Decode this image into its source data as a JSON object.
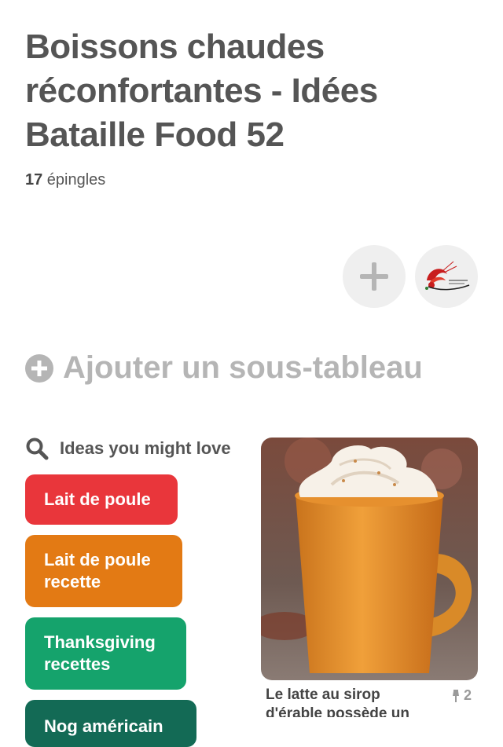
{
  "board": {
    "title": "Boissons chaudes réconfortantes - Idées Bataille Food 52",
    "pin_count": "17",
    "pin_count_label": " épingles"
  },
  "actions": {
    "add_icon": "plus-icon",
    "avatar_icon": "shrimp-logo-icon"
  },
  "subboard": {
    "label": "Ajouter un sous-tableau"
  },
  "ideas": {
    "header": "Ideas you might love",
    "chips": [
      {
        "label": "Lait de poule",
        "color": "#e9363b"
      },
      {
        "label": "Lait de poule recette",
        "color": "#e37a14"
      },
      {
        "label": "Thanksgiving recettes",
        "color": "#15a36c"
      },
      {
        "label": "Nog américain",
        "color": "#136a55"
      }
    ]
  },
  "pin": {
    "description": "Le latte au sirop d'érable possède un goût sucré et riche",
    "repin_count": "2"
  }
}
